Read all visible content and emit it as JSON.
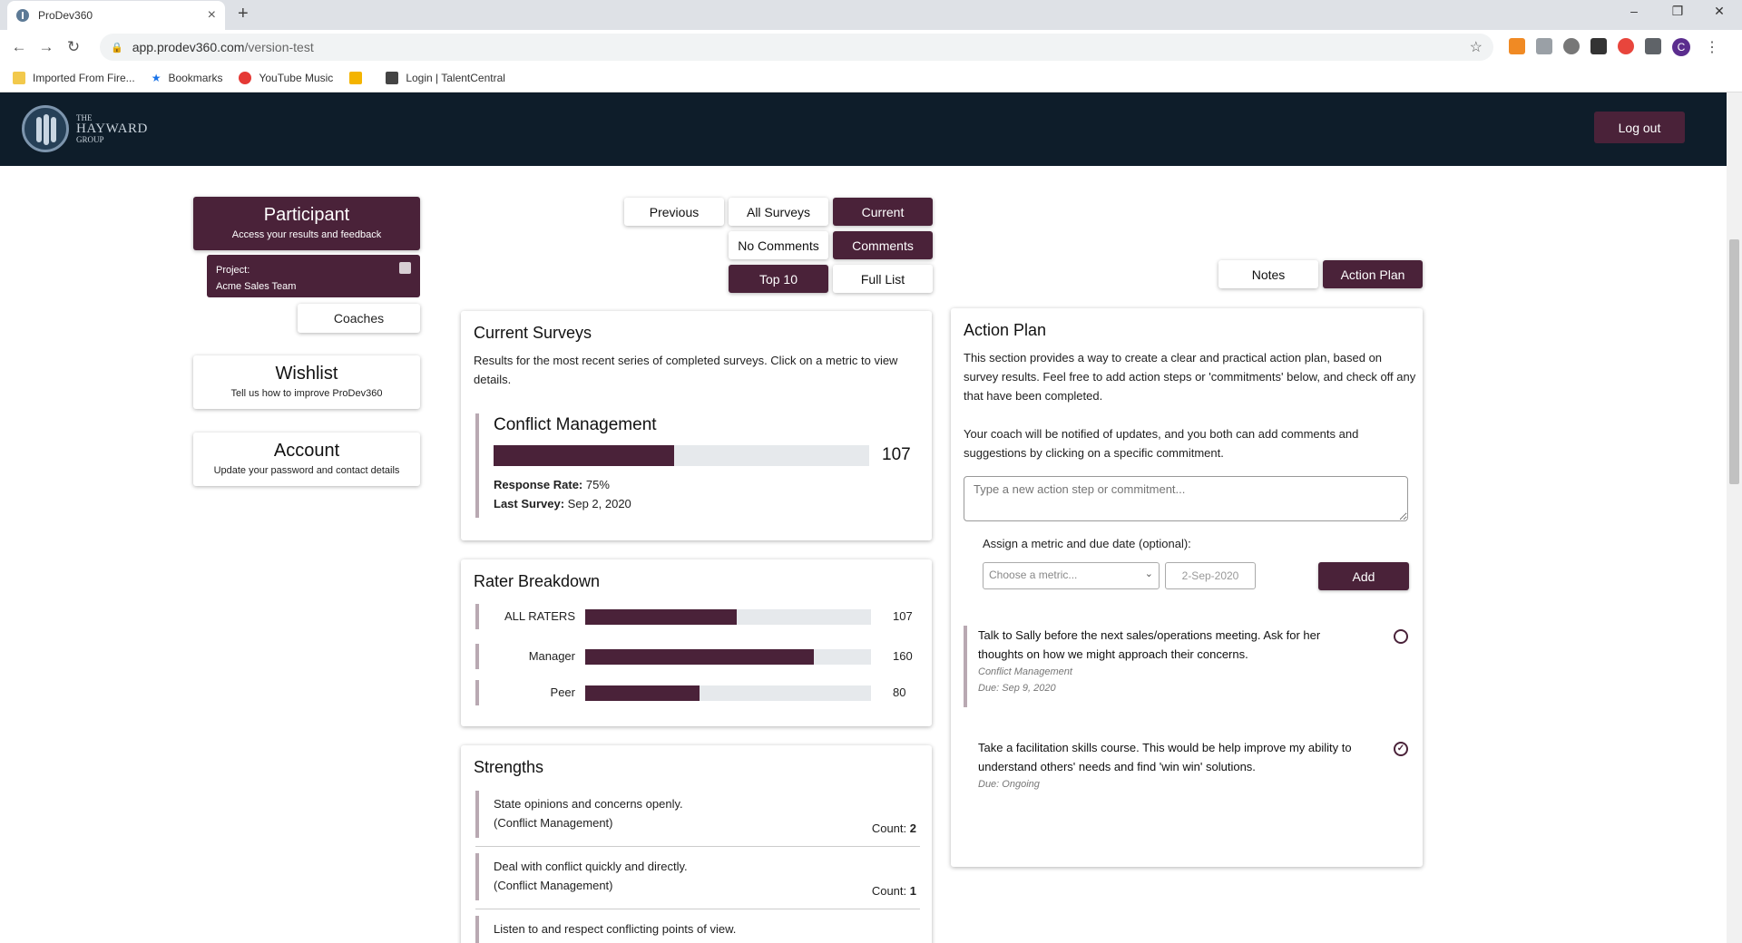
{
  "browser": {
    "tab_title": "ProDev360",
    "tab_close": "×",
    "new_tab": "+",
    "url_host": "app.prodev360.com",
    "url_path": "/version-test",
    "window_controls": [
      "–",
      "❐",
      "✕"
    ],
    "bookmarks": [
      {
        "label": "Imported From Fire...",
        "icon": "folder-icon",
        "color": "#f2c94c"
      },
      {
        "label": "Bookmarks",
        "icon": "star-icon",
        "color": "#1a73e8"
      },
      {
        "label": "YouTube Music",
        "icon": "youtube-music-icon",
        "color": "#e53935"
      },
      {
        "label": "",
        "icon": "rss-icon",
        "color": "#f4b400"
      },
      {
        "label": "Login | TalentCentral",
        "icon": "talentcentral-icon",
        "color": "#444444"
      }
    ],
    "profile_initial": "C"
  },
  "header": {
    "logo_line1": "THE",
    "logo_line2": "HAYWARD",
    "logo_line3": "GROUP",
    "logout_label": "Log out",
    "bg_color": "#0e1d2a",
    "accent_color": "#4a2239"
  },
  "sidebar": {
    "participant_title": "Participant",
    "participant_sub": "Access your results and feedback",
    "project_label": "Project:",
    "project_name": "Acme Sales Team",
    "coaches_label": "Coaches",
    "wishlist_title": "Wishlist",
    "wishlist_sub": "Tell us how to improve ProDev360",
    "account_title": "Account",
    "account_sub": "Update your password and contact details"
  },
  "filters": {
    "previous": "Previous",
    "all_surveys": "All Surveys",
    "current": "Current",
    "no_comments": "No Comments",
    "comments": "Comments",
    "top10": "Top 10",
    "full_list": "Full List",
    "notes": "Notes",
    "action_plan": "Action Plan"
  },
  "current_surveys": {
    "title": "Current Surveys",
    "description": "Results for the most recent series of completed surveys.  Click on a metric to view details.",
    "metric_name": "Conflict Management",
    "metric_value": "107",
    "metric_fill": 0.48,
    "response_rate_label": "Response Rate:",
    "response_rate": "75%",
    "last_survey_label": "Last Survey:",
    "last_survey": "Sep 2, 2020"
  },
  "rater_breakdown": {
    "title": "Rater Breakdown",
    "rows": [
      {
        "label": "ALL RATERS",
        "value": "107",
        "fill": 0.53
      },
      {
        "label": "Manager",
        "value": "160",
        "fill": 0.8
      },
      {
        "label": "Peer",
        "value": "80",
        "fill": 0.4
      }
    ]
  },
  "strengths": {
    "title": "Strengths",
    "count_label": "Count:",
    "items": [
      {
        "text": "State opinions and concerns openly.",
        "category": "(Conflict Management)",
        "count": "2"
      },
      {
        "text": "Deal with conflict quickly and directly.",
        "category": "(Conflict Management)",
        "count": "1"
      },
      {
        "text": "Listen to and respect conflicting points of view.",
        "category": "",
        "count": ""
      }
    ]
  },
  "action_plan": {
    "title": "Action Plan",
    "desc1": "This section provides a way to create a clear and practical action plan, based on survey results. Feel free to add action steps or 'commitments' below, and check off any that have been completed.",
    "desc2": "Your coach will be notified of updates, and you both can add comments and suggestions by clicking on a specific commitment.",
    "input_placeholder": "Type a new action step or commitment...",
    "assign_label": "Assign a metric and due date (optional):",
    "select_placeholder": "Choose a metric...",
    "date_value": "2-Sep-2020",
    "add_label": "Add",
    "commitments": [
      {
        "text": "Talk to Sally before the next sales/operations meeting. Ask for her thoughts on how we might approach their concerns.",
        "metric": "Conflict Management",
        "due": "Due: Sep 9, 2020",
        "done": false,
        "check": ""
      },
      {
        "text": "Take a facilitation skills course. This would be help improve my ability to understand others' needs and find 'win win' solutions.",
        "metric": "",
        "due": "Due: Ongoing",
        "done": true,
        "check": "✓"
      }
    ]
  }
}
